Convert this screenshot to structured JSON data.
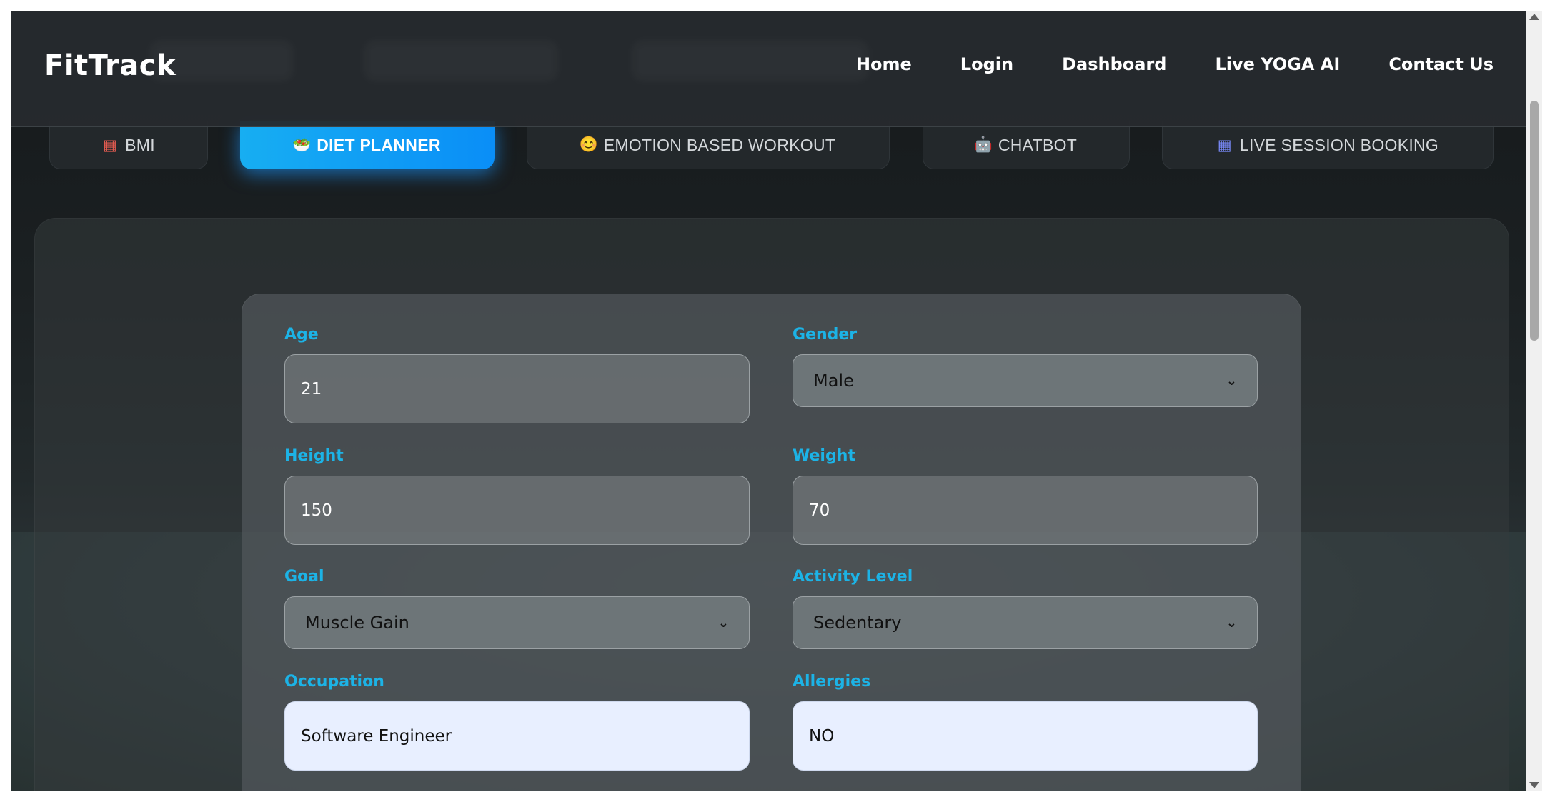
{
  "brand": "FitTrack",
  "nav": [
    "Home",
    "Login",
    "Dashboard",
    "Live YOGA AI",
    "Contact Us"
  ],
  "tabs": [
    {
      "label": "BMI",
      "icon": "abacus-icon",
      "glyph": "▦"
    },
    {
      "label": "DIET PLANNER",
      "icon": "salad-bowl-icon",
      "glyph": "🥗",
      "active": true
    },
    {
      "label": "EMOTION BASED WORKOUT",
      "icon": "smile-face-icon",
      "glyph": "😊"
    },
    {
      "label": "CHATBOT",
      "icon": "robot-icon",
      "glyph": "🤖"
    },
    {
      "label": "LIVE SESSION BOOKING",
      "icon": "calendar-icon",
      "glyph": "▦"
    }
  ],
  "form": {
    "age": {
      "label": "Age",
      "value": "21"
    },
    "gender": {
      "label": "Gender",
      "value": "Male"
    },
    "height": {
      "label": "Height",
      "value": "150"
    },
    "weight": {
      "label": "Weight",
      "value": "70"
    },
    "goal": {
      "label": "Goal",
      "value": "Muscle Gain"
    },
    "activity": {
      "label": "Activity Level",
      "value": "Sedentary"
    },
    "occupation": {
      "label": "Occupation",
      "value": "Software Engineer"
    },
    "allergies": {
      "label": "Allergies",
      "value": "NO"
    }
  },
  "colors": {
    "accent": "#1cb3e6",
    "active_tab": "#0a8ef7",
    "navbar": "#262a2e",
    "background": "#1b2022"
  }
}
